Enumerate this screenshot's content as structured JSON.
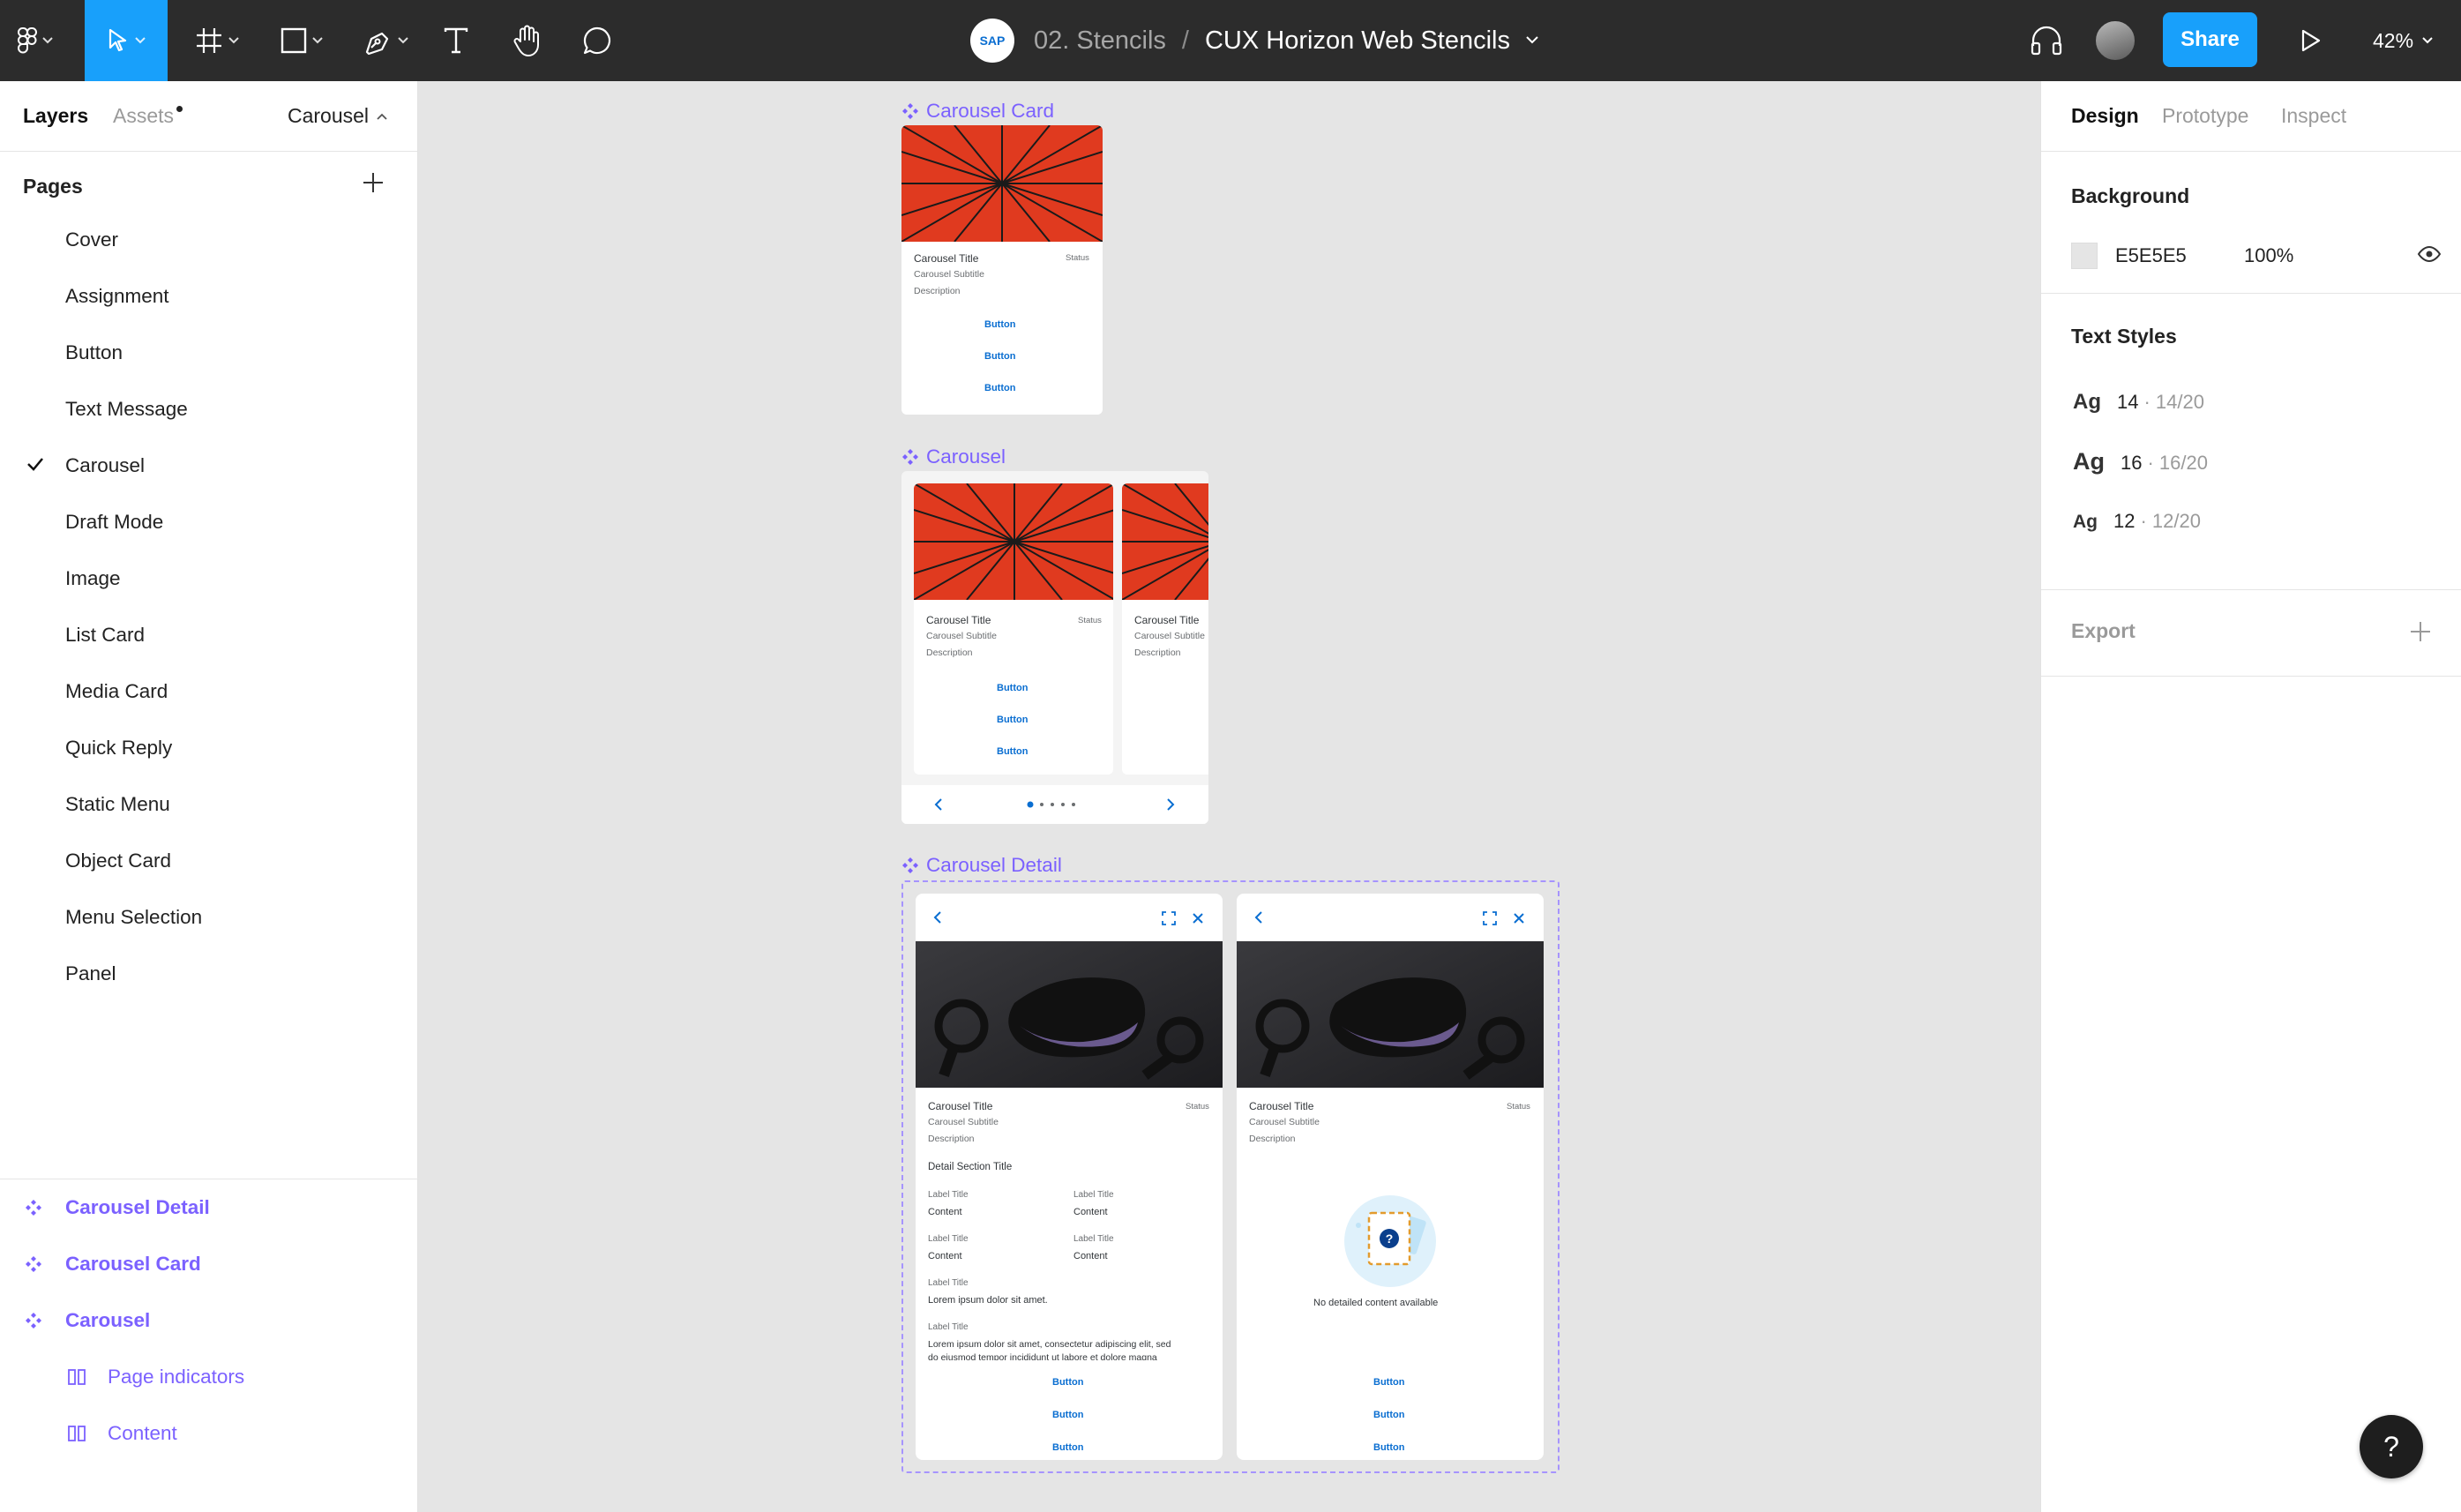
{
  "topbar": {
    "project": "02. Stencils",
    "separator": "/",
    "file": "CUX Horizon Web Stencils",
    "share_label": "Share",
    "zoom": "42%",
    "logo_text": "SAP",
    "tools": [
      "figma-menu-icon",
      "move-icon",
      "frame-icon",
      "shape-icon",
      "pen-icon",
      "text-icon",
      "hand-icon",
      "comment-icon"
    ]
  },
  "left_panel": {
    "tab_layers": "Layers",
    "tab_assets": "Assets",
    "current_page": "Carousel",
    "pages_heading": "Pages",
    "pages": [
      {
        "label": "Cover"
      },
      {
        "label": "Assignment"
      },
      {
        "label": "Button"
      },
      {
        "label": "Text Message"
      },
      {
        "label": "Carousel",
        "selected": true
      },
      {
        "label": "Draft Mode"
      },
      {
        "label": "Image"
      },
      {
        "label": "List Card"
      },
      {
        "label": "Media Card"
      },
      {
        "label": "Quick Reply"
      },
      {
        "label": "Static Menu"
      },
      {
        "label": "Object Card"
      },
      {
        "label": "Menu Selection"
      },
      {
        "label": "Panel"
      }
    ],
    "layers": [
      {
        "label": "Carousel Detail",
        "type": "component"
      },
      {
        "label": "Carousel Card",
        "type": "component"
      },
      {
        "label": "Carousel",
        "type": "component"
      },
      {
        "label": "Page indicators",
        "type": "frame"
      },
      {
        "label": "Content",
        "type": "frame"
      }
    ]
  },
  "right_panel": {
    "tab_design": "Design",
    "tab_prototype": "Prototype",
    "tab_inspect": "Inspect",
    "background_heading": "Background",
    "background_hex": "E5E5E5",
    "background_opacity": "100%",
    "text_styles_heading": "Text Styles",
    "text_styles": [
      {
        "ag": "Ag",
        "size": "14",
        "meta": "· 14/20"
      },
      {
        "ag": "Ag",
        "size": "16",
        "meta": "· 16/20"
      },
      {
        "ag": "Ag",
        "size": "12",
        "meta": "· 12/20"
      }
    ],
    "export_heading": "Export"
  },
  "canvas": {
    "carousel_card": {
      "label": "Carousel Card",
      "title": "Carousel Title",
      "subtitle": "Carousel Subtitle",
      "description": "Description",
      "status": "Status",
      "buttons": [
        "Button",
        "Button",
        "Button"
      ]
    },
    "carousel": {
      "label": "Carousel",
      "card1": {
        "title": "Carousel Title",
        "subtitle": "Carousel Subtitle",
        "description": "Description",
        "status": "Status",
        "buttons": [
          "Button",
          "Button",
          "Button"
        ]
      },
      "card2": {
        "title": "Carousel Title",
        "subtitle": "Carousel Subtitle",
        "description": "Description"
      }
    },
    "carousel_detail": {
      "label": "Carousel Detail",
      "detail1": {
        "title": "Carousel Title",
        "subtitle": "Carousel Subtitle",
        "description": "Description",
        "status": "Status",
        "section_title": "Detail Section Title",
        "fields": [
          {
            "label": "Label Title",
            "value": "Content"
          },
          {
            "label": "Label Title",
            "value": "Content"
          },
          {
            "label": "Label Title",
            "value": "Content"
          },
          {
            "label": "Label Title",
            "value": "Content"
          }
        ],
        "field5_label": "Label Title",
        "field5_value": "Lorem ipsum dolor sit amet.",
        "field6_label": "Label Title",
        "field6_line1": "Lorem ipsum dolor sit amet, consectetur adipiscing elit, sed",
        "field6_line2": "do eiusmod tempor incididunt ut labore et dolore magna",
        "buttons": [
          "Button",
          "Button",
          "Button"
        ]
      },
      "detail2": {
        "title": "Carousel Title",
        "subtitle": "Carousel Subtitle",
        "description": "Description",
        "status": "Status",
        "empty_text": "No detailed content available",
        "buttons": [
          "Button",
          "Button",
          "Button"
        ]
      }
    }
  },
  "colors": {
    "accent": "#18a0fb",
    "component": "#7b61ff",
    "banner": "#e03a1f",
    "link": "#0a6ed1"
  }
}
